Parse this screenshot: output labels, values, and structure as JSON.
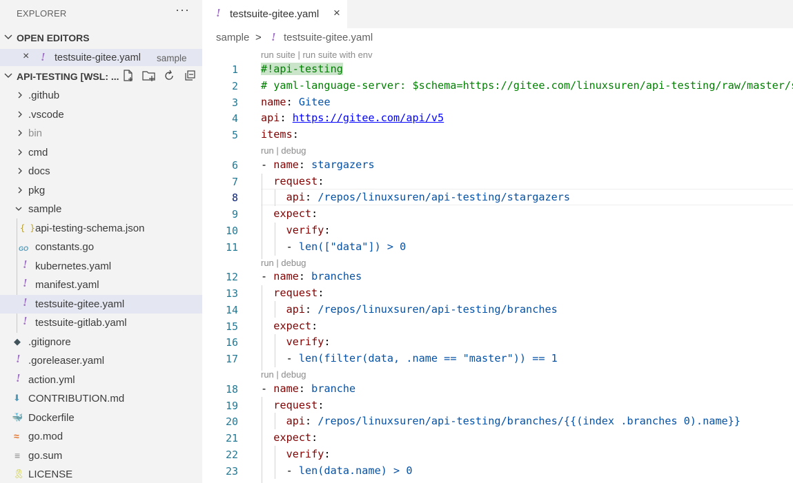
{
  "explorer": {
    "title": "EXPLORER",
    "more": "···",
    "open_editors_label": "OPEN EDITORS",
    "open_editors": [
      {
        "close": "×",
        "name": "testsuite-gitee.yaml",
        "desc": "sample"
      }
    ],
    "workspace_label": "API-TESTING [WSL: ...",
    "tree": [
      {
        "label": "github",
        "prefix": "."
      },
      {
        "label": "vscode",
        "prefix": "."
      },
      {
        "label": "bin"
      },
      {
        "label": "cmd"
      },
      {
        "label": "docs"
      },
      {
        "label": "pkg"
      },
      {
        "label": "sample"
      },
      {
        "label": "api-testing-schema.json",
        "icon": "{ }"
      },
      {
        "label": "constants.go",
        "icon": "GO"
      },
      {
        "label": "kubernetes.yaml",
        "icon": "!"
      },
      {
        "label": "manifest.yaml",
        "icon": "!"
      },
      {
        "label": "testsuite-gitee.yaml",
        "icon": "!"
      },
      {
        "label": "testsuite-gitlab.yaml",
        "icon": "!"
      },
      {
        "label": ".gitignore",
        "icon": "◆"
      },
      {
        "label": ".goreleaser.yaml",
        "icon": "!"
      },
      {
        "label": "action.yml",
        "icon": "!"
      },
      {
        "label": "CONTRIBUTION.md",
        "icon": "⬇"
      },
      {
        "label": "Dockerfile",
        "icon": "🐳"
      },
      {
        "label": "go.mod",
        "icon": "≈"
      },
      {
        "label": "go.sum",
        "icon": "≡"
      },
      {
        "label": "LICENSE",
        "icon": "🎗"
      }
    ]
  },
  "tab": {
    "icon": "!",
    "label": "testsuite-gitee.yaml",
    "close": "×"
  },
  "breadcrumb": {
    "folder": "sample",
    "sep": ">",
    "icon": "!",
    "file": "testsuite-gitee.yaml"
  },
  "editor": {
    "lens_suite": "run suite | run suite with env",
    "lens_case": "run | debug",
    "line_numbers": [
      "1",
      "2",
      "3",
      "4",
      "5",
      "6",
      "7",
      "8",
      "9",
      "10",
      "11",
      "12",
      "13",
      "14",
      "15",
      "16",
      "17",
      "18",
      "19",
      "20",
      "21",
      "22",
      "23"
    ],
    "lines": {
      "l1": "#!api-testing",
      "l2": "# yaml-language-server: $schema=https://gitee.com/linuxsuren/api-testing/raw/master/sample/api-testing-schema.json",
      "l3_key": "name",
      "l3_val": "Gitee",
      "l4_key": "api",
      "l4_val": "https://gitee.com/api/v5",
      "l5_key": "items",
      "l6_key": "name",
      "l6_val": "stargazers",
      "l7_key": "request",
      "l8_key": "api",
      "l8_val": "/repos/linuxsuren/api-testing/stargazers",
      "l9_key": "expect",
      "l10_key": "verify",
      "l11_val": "len([\"data\"]) > 0",
      "l12_key": "name",
      "l12_val": "branches",
      "l13_key": "request",
      "l14_key": "api",
      "l14_val": "/repos/linuxsuren/api-testing/branches",
      "l15_key": "expect",
      "l16_key": "verify",
      "l17_val": "len(filter(data, .name == \"master\")) == 1",
      "l18_key": "name",
      "l18_val": "branche",
      "l19_key": "request",
      "l20_key": "api",
      "l20_val": "/repos/linuxsuren/api-testing/branches/{{(index .branches 0).name}}",
      "l21_key": "expect",
      "l22_key": "verify",
      "l23_val": "len(data.name) > 0"
    }
  },
  "colors": {
    "accent_selection": "#e4e6f1",
    "line_number": "#237893",
    "yaml_key": "#800000",
    "yaml_value": "#0451a5",
    "comment": "#008000",
    "yaml_icon": "#a074c4"
  }
}
